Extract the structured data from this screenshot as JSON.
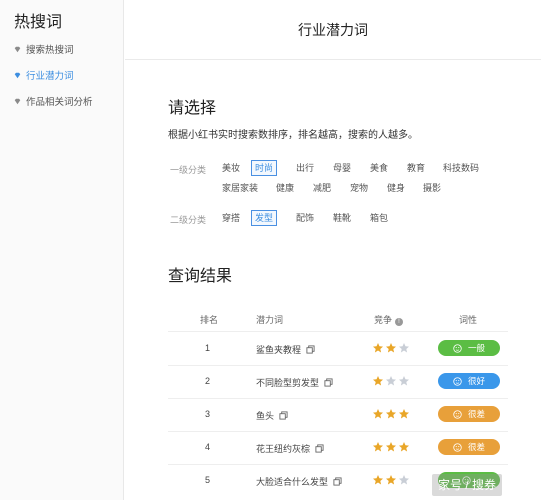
{
  "sidebar": {
    "title": "热搜词",
    "items": [
      {
        "label": "搜索热搜词",
        "active": false
      },
      {
        "label": "行业潜力词",
        "active": true
      },
      {
        "label": "作品相关词分析",
        "active": false
      }
    ]
  },
  "header": {
    "title": "行业潜力词"
  },
  "select_section": {
    "heading": "请选择",
    "description": "根据小红书实时搜索数排序，排名越高，搜索的人越多。",
    "level1": {
      "label": "一级分类",
      "options": [
        "美妆",
        "时尚",
        "出行",
        "母婴",
        "美食",
        "教育",
        "科技数码",
        "家居家装",
        "健康",
        "减肥",
        "宠物",
        "健身",
        "摄影"
      ],
      "selected": "时尚"
    },
    "level2": {
      "label": "二级分类",
      "options": [
        "穿搭",
        "发型",
        "配饰",
        "鞋靴",
        "箱包"
      ],
      "selected": "发型"
    }
  },
  "results": {
    "heading": "查询结果",
    "columns": [
      "排名",
      "潜力词",
      "竞争",
      "词性"
    ],
    "rows": [
      {
        "rank": "1",
        "word": "鲨鱼夹教程",
        "competition": 2,
        "sentiment": "一般",
        "sentiment_color": "#5bbd44"
      },
      {
        "rank": "2",
        "word": "不同脸型剪发型",
        "competition": 1,
        "sentiment": "很好",
        "sentiment_color": "#3a97ea"
      },
      {
        "rank": "3",
        "word": "鱼头",
        "competition": 3,
        "sentiment": "很差",
        "sentiment_color": "#e8a03a"
      },
      {
        "rank": "4",
        "word": "花王纽约灰棕",
        "competition": 3,
        "sentiment": "很差",
        "sentiment_color": "#e8a03a"
      },
      {
        "rank": "5",
        "word": "大脸适合什么发型",
        "competition": 2,
        "sentiment": "",
        "sentiment_color": "#5bbd44"
      }
    ],
    "max_stars": 3
  },
  "watermark": "家号 / 搜券",
  "colors": {
    "accent": "#3c8ee0",
    "star_on": "#e9a628",
    "star_off": "#c9ced6"
  }
}
